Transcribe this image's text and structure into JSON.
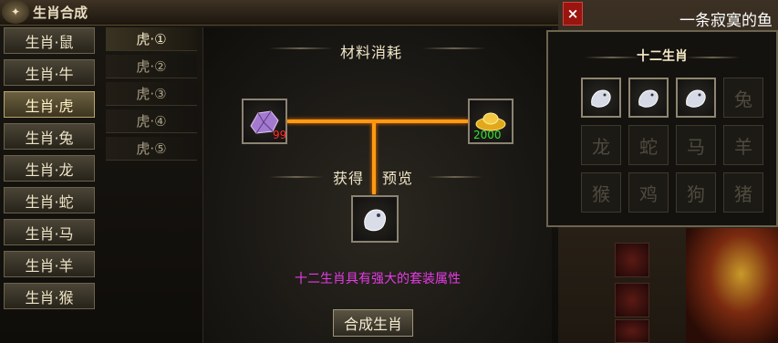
{
  "window": {
    "title": "生肖合成",
    "title_icon": "zodiac-emblem-icon",
    "close_label": "×"
  },
  "zodiac_list": [
    {
      "label": "生肖·鼠",
      "active": false
    },
    {
      "label": "生肖·牛",
      "active": false
    },
    {
      "label": "生肖·虎",
      "active": true
    },
    {
      "label": "生肖·兔",
      "active": false
    },
    {
      "label": "生肖·龙",
      "active": false
    },
    {
      "label": "生肖·蛇",
      "active": false
    },
    {
      "label": "生肖·马",
      "active": false
    },
    {
      "label": "生肖·羊",
      "active": false
    },
    {
      "label": "生肖·猴",
      "active": false
    }
  ],
  "sub_list": [
    {
      "label": "虎·①",
      "active": true
    },
    {
      "label": "虎·②",
      "active": false
    },
    {
      "label": "虎·③",
      "active": false
    },
    {
      "label": "虎·④",
      "active": false
    },
    {
      "label": "虎·⑤",
      "active": false
    }
  ],
  "center": {
    "materials_header": "材料消耗",
    "material_1": {
      "icon": "purple-ore-icon",
      "count": "99",
      "count_color": "#ff2a2a"
    },
    "material_2": {
      "icon": "gold-ingot-icon",
      "count": "2000",
      "count_color": "#33e033"
    },
    "result_header_1": "获得",
    "result_header_2": "预览",
    "result_item": {
      "icon": "white-tiger-figure-icon"
    },
    "description": "十二生肖具有强大的套装属性",
    "compose_button": "合成生肖"
  },
  "zodiac_grid": {
    "title": "十二生肖",
    "cells": [
      {
        "label": "鼠",
        "lit": true,
        "icon": "rat-figure-icon"
      },
      {
        "label": "牛",
        "lit": true,
        "icon": "ox-figure-icon"
      },
      {
        "label": "虎",
        "lit": true,
        "icon": "tiger-figure-icon"
      },
      {
        "label": "兔",
        "lit": false
      },
      {
        "label": "龙",
        "lit": false
      },
      {
        "label": "蛇",
        "lit": false
      },
      {
        "label": "马",
        "lit": false
      },
      {
        "label": "羊",
        "lit": false
      },
      {
        "label": "猴",
        "lit": false
      },
      {
        "label": "鸡",
        "lit": false
      },
      {
        "label": "狗",
        "lit": false
      },
      {
        "label": "猪",
        "lit": false
      }
    ]
  },
  "background": {
    "player_name": "一条寂寞的鱼"
  }
}
